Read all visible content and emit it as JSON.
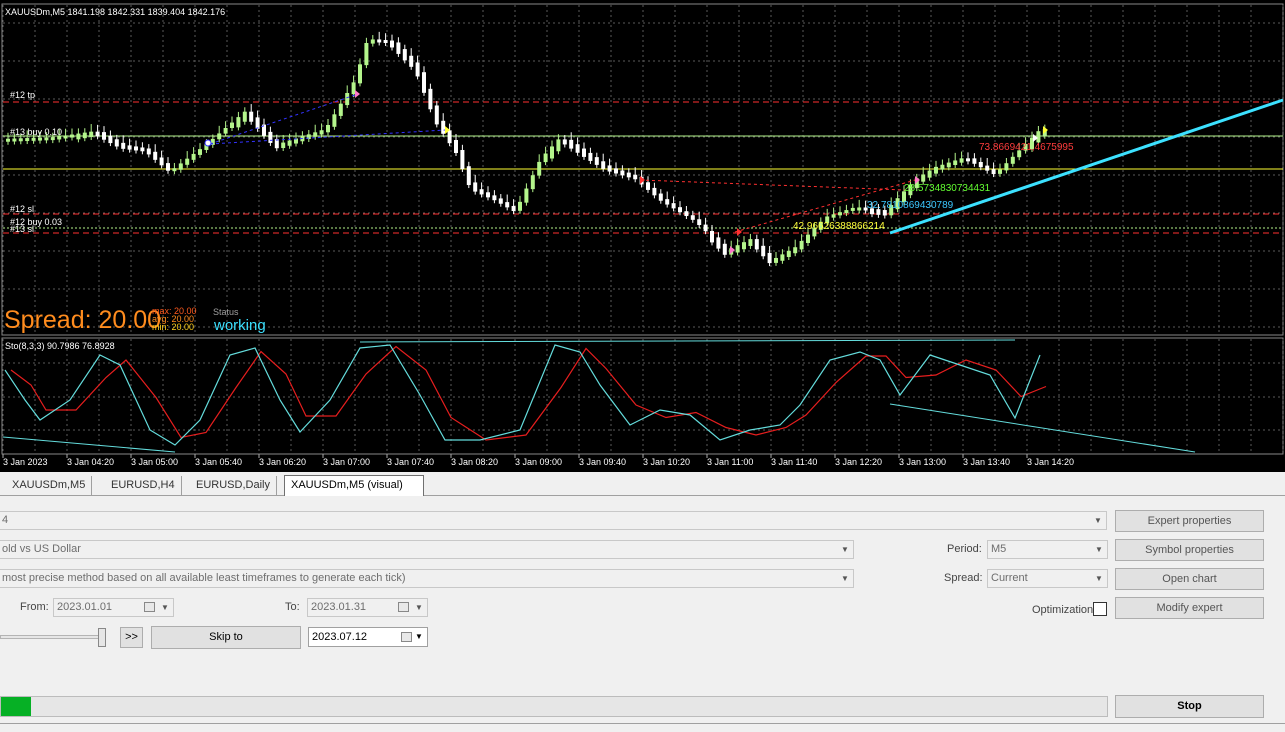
{
  "chart": {
    "symbol_info": "XAUUSDm,M5  1841.198 1842.331 1839.404 1842.176",
    "level_labels": [
      "#12 tp",
      "#13 buy 0.10",
      "#12 sl",
      "#12 buy 0.03",
      "#13 sl"
    ],
    "spread_label": "Spread: 20.00",
    "spread_stats": [
      "max: 20.00",
      "avg: 20.00",
      "min: 20.00"
    ],
    "status_label": "Status",
    "status_value": "working",
    "trade_labels": [
      "73.8669421,4675995",
      "28.5734830734431",
      "32.7810869430789",
      "42.96626388866214"
    ],
    "stoch_label": "Sto(8,3,3) 90.7986 76.8928",
    "time_labels": [
      "3 Jan 2023",
      "3 Jan 04:20",
      "3 Jan 05:00",
      "3 Jan 05:40",
      "3 Jan 06:20",
      "3 Jan 07:00",
      "3 Jan 07:40",
      "3 Jan 08:20",
      "3 Jan 09:00",
      "3 Jan 09:40",
      "3 Jan 10:20",
      "3 Jan 11:00",
      "3 Jan 11:40",
      "3 Jan 12:20",
      "3 Jan 13:00",
      "3 Jan 13:40",
      "3 Jan 14:20"
    ],
    "colors": {
      "bull": "#b4f58c",
      "bear": "#ffffff",
      "grid": "#5a5a5a",
      "spread": "#ff8c1e",
      "working": "#3ce1ff",
      "stoch_main": "#64dcdc",
      "stoch_signal": "#e61e1e"
    }
  },
  "tabs": [
    "XAUUSDm,M5",
    "EURUSD,H4",
    "EURUSD,Daily",
    "XAUUSDm,M5 (visual)"
  ],
  "tester": {
    "expert_value": "4",
    "symbol_value": "old vs US Dollar",
    "model_value": "most precise method based on all available least timeframes to generate each tick)",
    "period_label": "Period:",
    "period_value": "M5",
    "spread_label": "Spread:",
    "spread_value": "Current",
    "from_label": "From:",
    "from_value": "2023.01.01",
    "to_label": "To:",
    "to_value": "2023.01.31",
    "optimization_label": "Optimization",
    "speed_button": ">>",
    "skip_to_label": "Skip to",
    "skip_date": "2023.07.12",
    "progress": 0.027,
    "buttons": {
      "expert_properties": "Expert properties",
      "symbol_properties": "Symbol properties",
      "open_chart": "Open chart",
      "modify_expert": "Modify expert",
      "stop": "Stop"
    }
  }
}
